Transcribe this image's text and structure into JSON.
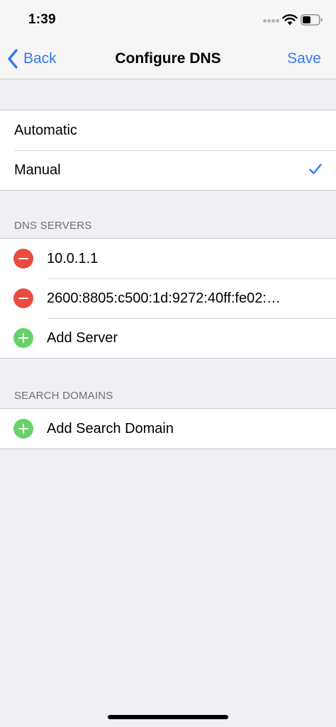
{
  "status_bar": {
    "time": "1:39"
  },
  "nav": {
    "back_label": "Back",
    "title": "Configure DNS",
    "save_label": "Save"
  },
  "configure": {
    "options": [
      {
        "label": "Automatic",
        "selected": false
      },
      {
        "label": "Manual",
        "selected": true
      }
    ]
  },
  "dns_servers": {
    "header": "DNS SERVERS",
    "servers": [
      "10.0.1.1",
      "2600:8805:c500:1d:9272:40ff:fe02:…"
    ],
    "add_label": "Add Server"
  },
  "search_domains": {
    "header": "SEARCH DOMAINS",
    "add_label": "Add Search Domain"
  },
  "colors": {
    "accent": "#3478f6",
    "remove": "#ea4b3f",
    "add": "#66d36a",
    "background": "#efeff4"
  }
}
